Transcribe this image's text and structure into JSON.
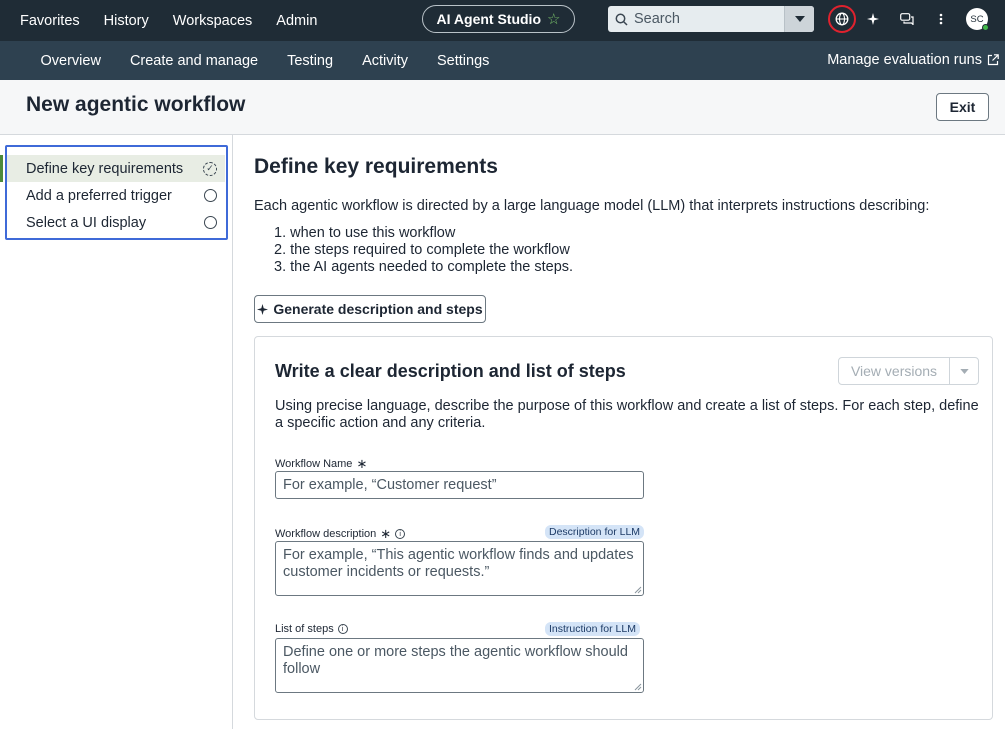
{
  "topnav": {
    "items": [
      "Favorites",
      "History",
      "Workspaces",
      "Admin"
    ]
  },
  "studio": {
    "label": "AI Agent Studio"
  },
  "search": {
    "placeholder": "Search"
  },
  "user": {
    "initials": "SC"
  },
  "subnav": {
    "items": [
      "Overview",
      "Create and manage",
      "Testing",
      "Activity",
      "Settings"
    ],
    "manage_link": "Manage evaluation runs"
  },
  "page": {
    "title": "New agentic workflow",
    "exit_label": "Exit"
  },
  "steps": [
    {
      "label": "Define key requirements"
    },
    {
      "label": "Add a preferred trigger"
    },
    {
      "label": "Select a UI display"
    }
  ],
  "main": {
    "title": "Define key requirements",
    "intro": "Each agentic workflow is directed by a large language model (LLM) that interprets instructions describing:",
    "list": [
      "when to use this workflow",
      "the steps required to complete the workflow",
      "the AI agents needed to complete the steps."
    ],
    "generate_label": "Generate description and steps"
  },
  "card": {
    "title": "Write a clear description and list of steps",
    "versions_label": "View versions",
    "description": "Using precise language, describe the purpose of this workflow and create a list of steps. For each step, define a specific action and any criteria.",
    "fields": {
      "name": {
        "label": "Workflow Name",
        "placeholder": "For example, “Customer request”"
      },
      "description": {
        "label": "Workflow description",
        "tag": "Description for LLM",
        "placeholder": "For example, “This agentic workflow finds and updates customer incidents or requests.”"
      },
      "steps": {
        "label": "List of steps",
        "tag": "Instruction for LLM",
        "placeholder": "Define one or more steps the agentic workflow should follow"
      }
    }
  },
  "colors": {
    "topbar": "#1f2c36",
    "subbar": "#2e4150",
    "highlight_box": "#3f6ad8",
    "active_step": "#4e8a3a",
    "llm_tag": "#d4e4f7"
  },
  "icons": [
    "star-icon",
    "search-icon",
    "chevron-down-icon",
    "globe-icon",
    "sparkle-icon",
    "chat-icon",
    "more-vertical-icon",
    "external-link-icon",
    "check-circle-icon",
    "radio-empty-icon",
    "info-icon"
  ]
}
